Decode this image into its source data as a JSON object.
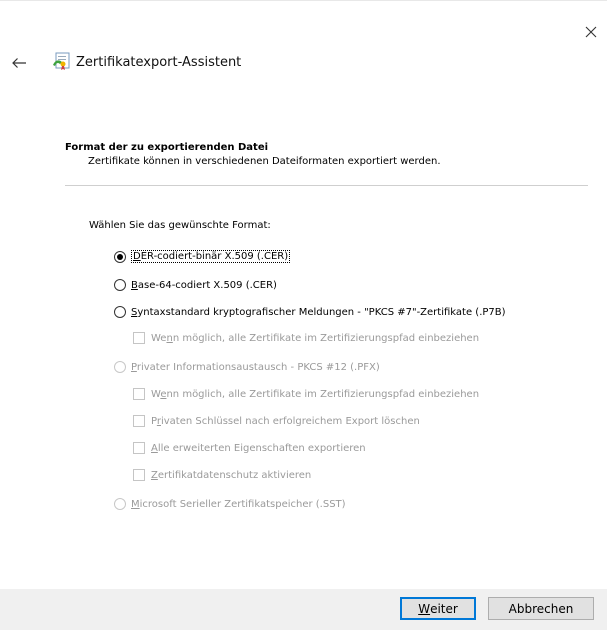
{
  "window": {
    "title": "Zertifikatexport-Assistent"
  },
  "section": {
    "heading": "Format der zu exportierenden Datei",
    "subheading": "Zertifikate können in verschiedenen Dateiformaten exportiert werden."
  },
  "prompt": "Wählen Sie das gewünschte Format:",
  "options": {
    "der": {
      "mnemonic": "D",
      "rest": "ER-codiert-binär X.509 (.CER)",
      "checked": true,
      "enabled": true
    },
    "base64": {
      "mnemonic": "B",
      "rest": "ase-64-codiert X.509 (.CER)",
      "checked": false,
      "enabled": true
    },
    "pkcs7": {
      "mnemonic": "S",
      "rest": "yntaxstandard kryptografischer Meldungen - \"PKCS #7\"-Zertifikate (.P7B)",
      "checked": false,
      "enabled": true
    },
    "pkcs7_include": {
      "pre": "We",
      "mnemonic": "n",
      "rest": "n möglich, alle Zertifikate im Zertifizierungspfad einbeziehen",
      "checked": false,
      "enabled": false
    },
    "pfx": {
      "mnemonic": "P",
      "rest": "rivater Informationsaustausch - PKCS #12 (.PFX)",
      "checked": false,
      "enabled": false
    },
    "pfx_include": {
      "pre": "W",
      "mnemonic": "e",
      "rest": "nn möglich, alle Zertifikate im Zertifizierungspfad einbeziehen",
      "checked": false,
      "enabled": false
    },
    "pfx_delete": {
      "pre": "P",
      "mnemonic": "r",
      "rest": "ivaten Schlüssel nach erfolgreichem Export löschen",
      "checked": false,
      "enabled": false
    },
    "pfx_ext": {
      "pre": "",
      "mnemonic": "A",
      "rest": "lle erweiterten Eigenschaften exportieren",
      "checked": false,
      "enabled": false
    },
    "pfx_privacy": {
      "pre": "",
      "mnemonic": "Z",
      "rest": "ertifikatdatenschutz aktivieren",
      "checked": false,
      "enabled": false
    },
    "sst": {
      "mnemonic": "M",
      "rest": "icrosoft Serieller Zertifikatspeicher (.SST)",
      "checked": false,
      "enabled": false
    }
  },
  "buttons": {
    "next": {
      "mnemonic": "W",
      "rest": "eiter"
    },
    "cancel": "Abbrechen"
  },
  "icons": {
    "close": "close-icon",
    "back": "back-arrow-icon",
    "wizard": "certificate-wizard-icon"
  }
}
